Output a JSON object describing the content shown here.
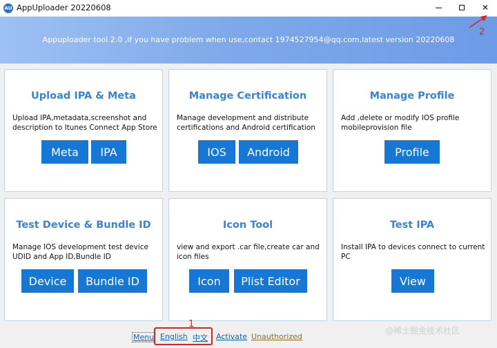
{
  "window": {
    "title": "AppUploader 20220608",
    "icon_label": "AU",
    "minimize_icon": "minimize-icon",
    "maximize_icon": "maximize-icon",
    "close_symbol": "✕"
  },
  "banner": {
    "text": "Appuploader tool 2.0 ,if you have problem when use,contact 1974527954@qq.com,latest version 20220608"
  },
  "cards": [
    {
      "title": "Upload IPA & Meta",
      "desc": "Upload IPA,metadata,screenshot and description to Itunes Connect App Store",
      "buttons": [
        "Meta",
        "IPA"
      ]
    },
    {
      "title": "Manage Certification",
      "desc": "Manage development and distribute certifications and Android certification",
      "buttons": [
        "IOS",
        "Android"
      ]
    },
    {
      "title": "Manage Profile",
      "desc": "Add ,delete or modify IOS profile mobileprovision file",
      "buttons": [
        "Profile"
      ]
    },
    {
      "title": "Test Device & Bundle ID",
      "desc": "Manage IOS development test device UDID and App ID,Bundle ID",
      "buttons": [
        "Device",
        "Bundle ID"
      ]
    },
    {
      "title": "Icon Tool",
      "desc": "view and export .car file,create car and icon files",
      "buttons": [
        "Icon",
        "Plist Editor"
      ]
    },
    {
      "title": "Test IPA",
      "desc": "Install IPA to devices connect to current PC",
      "buttons": [
        "View"
      ]
    }
  ],
  "footer": {
    "menu": "Menu",
    "english": "English",
    "chinese": "中文",
    "activate": "Activate",
    "unauthorized": "Unauthorized"
  },
  "annotations": {
    "marker_1": "1",
    "marker_2": "2"
  },
  "watermark": "@稀土掘金技术社区",
  "colors": {
    "accent": "#1677d4",
    "title_blue": "#3b82d0",
    "annotation_red": "#e02020"
  }
}
